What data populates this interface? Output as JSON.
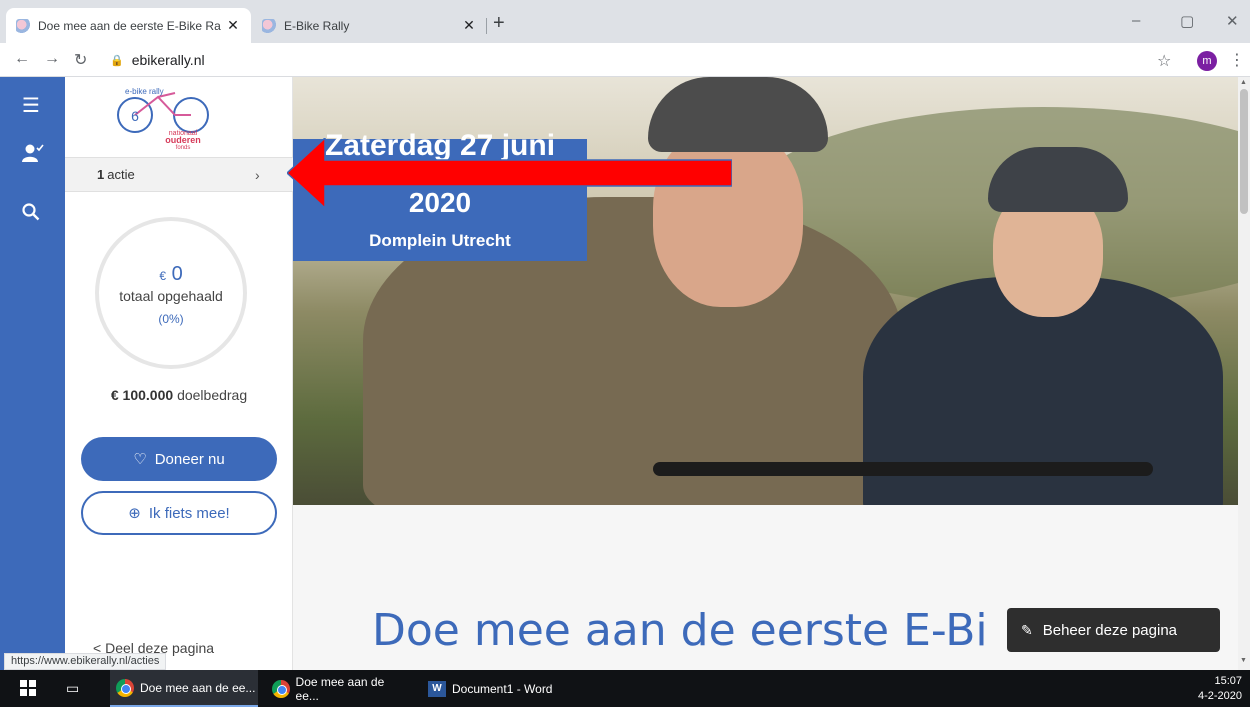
{
  "browser": {
    "tabs": [
      {
        "title": "Doe mee aan de eerste E-Bike Ra",
        "active": true
      },
      {
        "title": "E-Bike Rally",
        "active": false
      }
    ],
    "new_tab": "+",
    "url": "ebikerally.nl",
    "avatar_letter": "m",
    "window_controls": [
      "–",
      "▢",
      "✕"
    ]
  },
  "leftnav": {
    "icons": [
      "menu-icon",
      "user-check-icon",
      "search-icon"
    ]
  },
  "sidebar": {
    "logo_text": [
      "e-bike rally",
      "6",
      "nationaal",
      "ouderen",
      "fonds"
    ],
    "actie_count": "1",
    "actie_label": "actie",
    "amount_currency": "€",
    "amount_value": "0",
    "amount_label": "totaal opgehaald",
    "amount_pct": "(0%)",
    "goal_amount": "€ 100.000",
    "goal_label": "doelbedrag",
    "donate_button": "Doneer nu",
    "ride_button": "Ik fiets mee!",
    "share_label": "Deel deze pagina"
  },
  "hero": {
    "date_line1": "Zaterdag 27 juni",
    "date_line2": "2020",
    "location": "Domplein Utrecht"
  },
  "main": {
    "headline": "Doe mee aan de eerste E-Bi"
  },
  "manage_button": "Beheer deze pagina",
  "status_url": "https://www.ebikerally.nl/acties",
  "colors": {
    "brand_blue": "#3d6aba",
    "annotation_red": "#ff0000"
  },
  "taskbar": {
    "items": [
      {
        "label": "Doe mee aan de ee...",
        "app": "chrome",
        "active": true
      },
      {
        "label": "Doe mee aan de ee...",
        "app": "chrome",
        "active": false
      },
      {
        "label": "Document1 - Word",
        "app": "word",
        "active": false
      }
    ],
    "time": "15:07",
    "date": "4-2-2020"
  }
}
